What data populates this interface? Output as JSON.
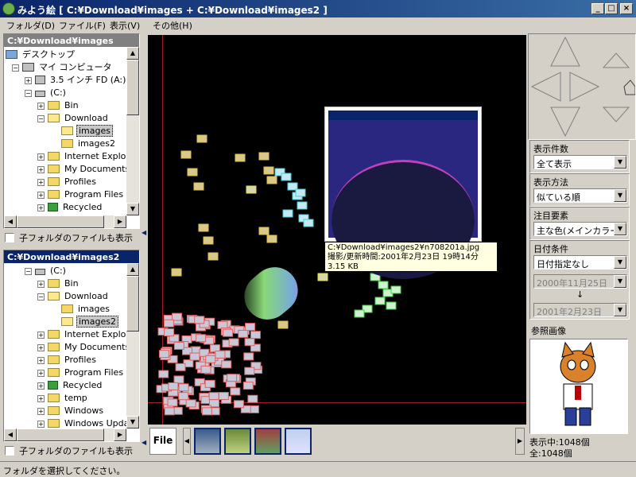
{
  "window": {
    "title": "みよう絵 [ C:¥Download¥images + C:¥Download¥images2 ]",
    "buttons": {
      "minimize": "_",
      "maximize": "□",
      "close": "×"
    }
  },
  "menu": [
    "フォルダ(D)",
    "ファイル(F)",
    "表示(V)",
    "その他(H)"
  ],
  "tree1": {
    "header": "C:¥Download¥images",
    "items": [
      {
        "label": "デスクトップ"
      },
      {
        "label": "マイ コンピュータ"
      },
      {
        "label": "3.5 インチ FD (A:)"
      },
      {
        "label": "(C:)"
      },
      {
        "label": "Bin"
      },
      {
        "label": "Download"
      },
      {
        "label": "images"
      },
      {
        "label": "images2"
      },
      {
        "label": "Internet Explor"
      },
      {
        "label": "My Documents"
      },
      {
        "label": "Profiles"
      },
      {
        "label": "Program Files"
      },
      {
        "label": "Recycled"
      }
    ],
    "checkbox_label": "子フォルダのファイルも表示"
  },
  "tree2": {
    "header": "C:¥Download¥images2",
    "items": [
      {
        "label": "(C:)"
      },
      {
        "label": "Bin"
      },
      {
        "label": "Download"
      },
      {
        "label": "images"
      },
      {
        "label": "images2"
      },
      {
        "label": "Internet Explor"
      },
      {
        "label": "My Documents"
      },
      {
        "label": "Profiles"
      },
      {
        "label": "Program Files"
      },
      {
        "label": "Recycled"
      },
      {
        "label": "temp"
      },
      {
        "label": "Windows"
      },
      {
        "label": "Windows Upda"
      }
    ],
    "checkbox_label": "子フォルダのファイルも表示"
  },
  "tooltip": {
    "path": "C:¥Download¥images2¥n708201a.jpg",
    "date": "撮影/更新時間:2001年2月23日 19時14分",
    "size": "3.15 KB"
  },
  "right": {
    "count_label": "表示件数",
    "count_value": "全て表示",
    "method_label": "表示方法",
    "method_value": "似ている順",
    "focus_label": "注目要素",
    "focus_value": "主な色(メインカラー)",
    "date_label": "日付条件",
    "date_value": "日付指定なし",
    "date_from": "2000年11月25日",
    "date_arrow": "↓",
    "date_to": "2001年2月23日",
    "ref_label": "参照画像",
    "shown": "表示中:1048個",
    "total": "全:1048個"
  },
  "filmstrip": {
    "file_label": "File"
  },
  "status": "フォルダを選択してください。"
}
